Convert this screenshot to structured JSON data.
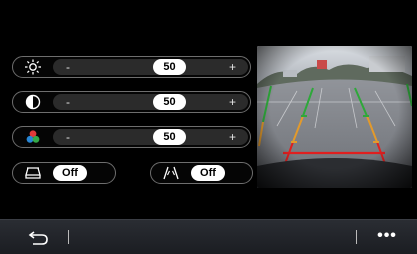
{
  "settings": {
    "brightness": {
      "value": "50",
      "minus": "-",
      "plus": "+"
    },
    "contrast": {
      "value": "50",
      "minus": "-",
      "plus": "+"
    },
    "color": {
      "value": "50",
      "minus": "-",
      "plus": "+"
    }
  },
  "toggles": {
    "view_toggle_1": {
      "label": "Off"
    },
    "view_toggle_2": {
      "label": "Off"
    }
  },
  "bottom_bar": {
    "more_label": "•••"
  },
  "icons": {
    "brightness": "sun-icon",
    "contrast": "contrast-icon",
    "color": "color-dots-icon",
    "toggle_1": "car-outline-icon",
    "toggle_2": "parking-guidelines-icon",
    "back": "back-arrow-icon",
    "more": "more-icon"
  },
  "colors": {
    "guide_green": "#2ea83a",
    "guide_orange": "#e39a2b",
    "guide_red": "#e01f1f"
  }
}
